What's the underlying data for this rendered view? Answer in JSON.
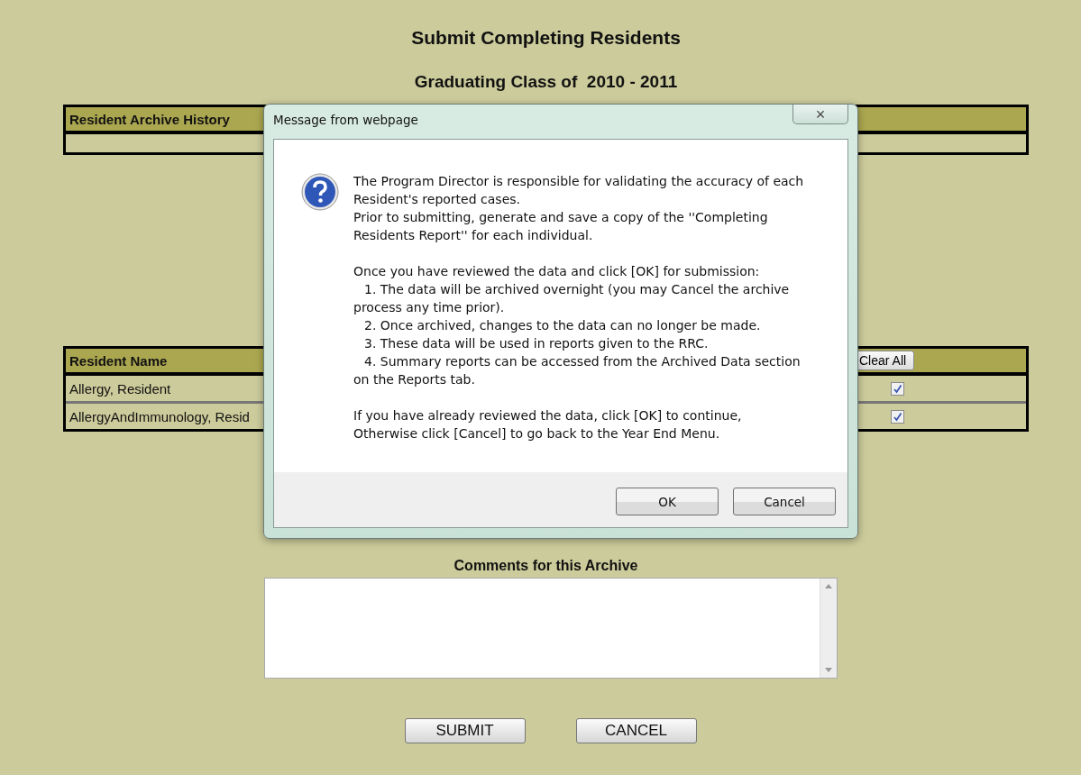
{
  "page": {
    "title": "Submit Completing Residents",
    "subtitle": "Graduating Class of  2010 - 2011"
  },
  "archive_table": {
    "header": "Resident Archive History"
  },
  "residents_table": {
    "header": "Resident Name",
    "clear_button": "Clear All",
    "rows": [
      {
        "name": "Allergy, Resident",
        "checked": true
      },
      {
        "name": "AllergyAndImmunology, Resid",
        "checked": true
      }
    ]
  },
  "comments": {
    "label": "Comments for this Archive"
  },
  "buttons": [
    "SUBMIT",
    "CANCEL"
  ],
  "dialog": {
    "title": "Message from webpage",
    "close": "×",
    "paragraphs": [
      [
        {
          "kind": "text",
          "text": "The Program Director is responsible for validating the accuracy of each Resident's reported cases."
        },
        {
          "kind": "text",
          "text": "Prior to submitting, generate and save a copy of the ''Completing Residents Report'' for each individual."
        }
      ],
      [
        {
          "kind": "text",
          "text": "Once you have reviewed the data and click [OK] for submission:"
        },
        {
          "kind": "item",
          "text": "1. The data will be archived overnight (you may Cancel the archive process any time prior)."
        },
        {
          "kind": "item",
          "text": "2. Once archived, changes to the data can no longer be made."
        },
        {
          "kind": "item",
          "text": "3. These data will be used in reports given to the RRC."
        },
        {
          "kind": "item",
          "text": "4. Summary reports can be accessed from the Archived Data section on the Reports tab."
        }
      ],
      [
        {
          "kind": "text",
          "text": "If you have already reviewed the data, click [OK] to continue,"
        },
        {
          "kind": "text",
          "text": "Otherwise click [Cancel] to go back to the Year End Menu."
        }
      ]
    ],
    "buttons": [
      "OK",
      "Cancel"
    ]
  }
}
